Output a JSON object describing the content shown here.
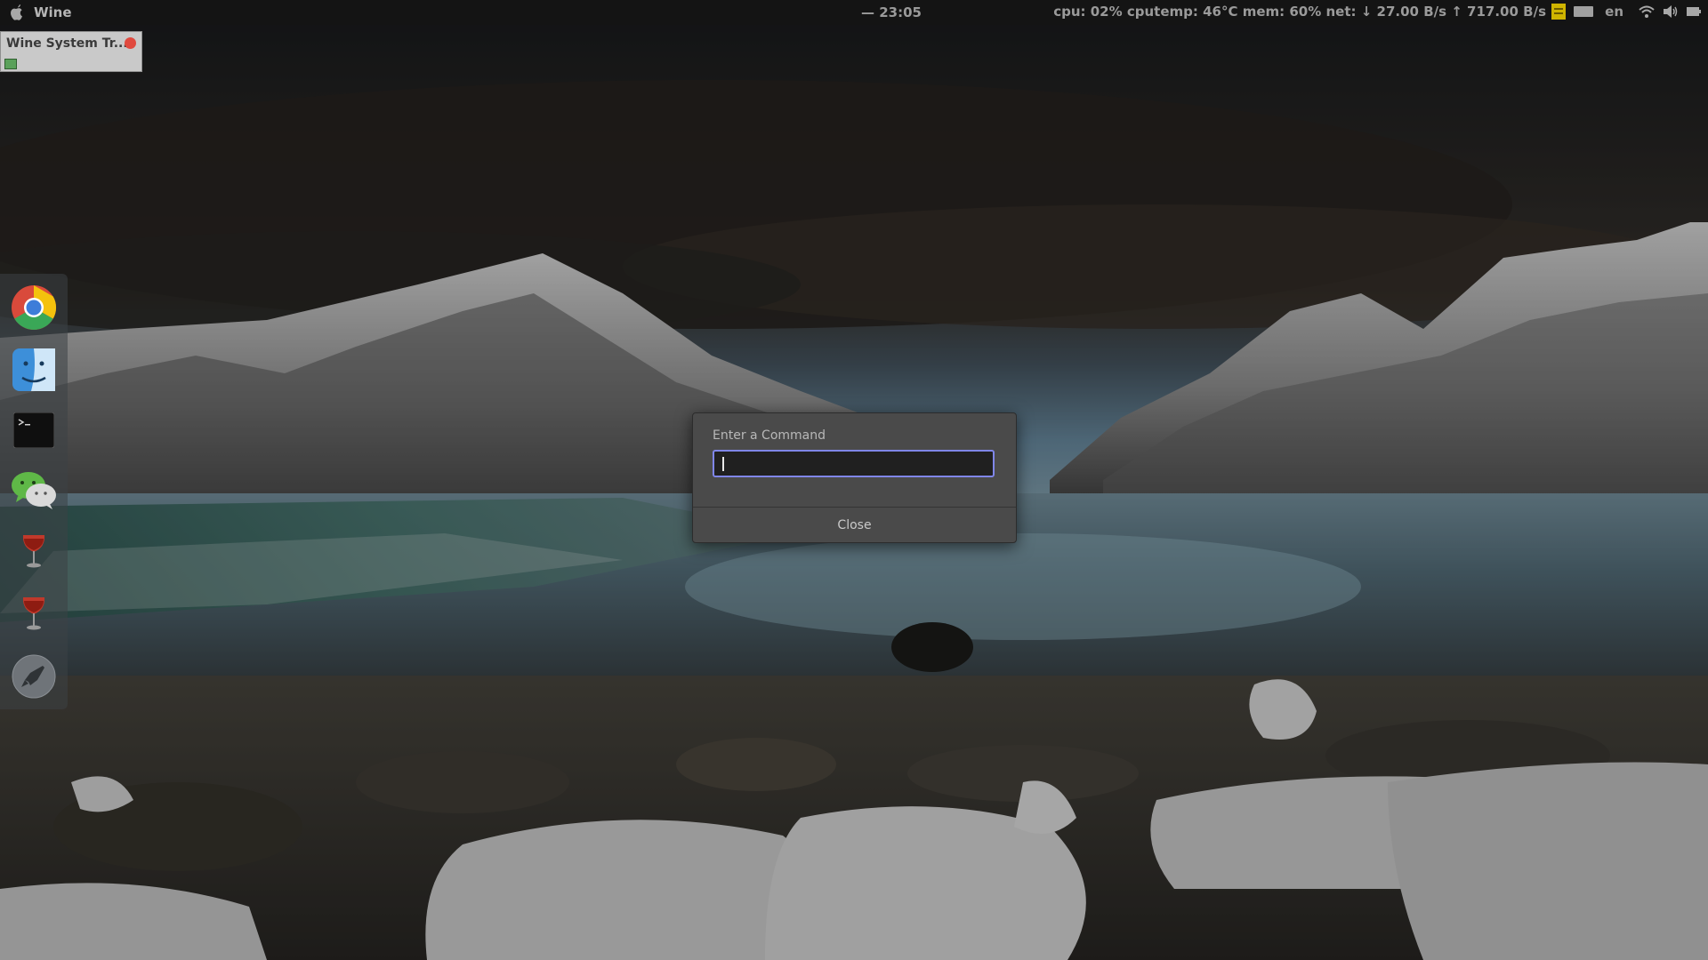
{
  "topbar": {
    "app_name": "Wine",
    "clock": "— 23:05",
    "status": "cpu: 02% cputemp: 46°C mem: 60% net: ↓  27.00 B/s ↑  717.00 B/s",
    "language": "en"
  },
  "systray_window": {
    "title": "Wine System Tr..."
  },
  "dock": {
    "items": [
      "chrome-icon",
      "finder-icon",
      "terminal-icon",
      "wechat-icon",
      "wine-icon",
      "wine-icon",
      "launchpad-icon"
    ]
  },
  "dialog": {
    "prompt": "Enter a Command",
    "input_value": "",
    "close_label": "Close"
  },
  "colors": {
    "accent_focus": "#7f86e8",
    "topbar_bg": "#141414",
    "dialog_bg": "#4a4a4a"
  }
}
